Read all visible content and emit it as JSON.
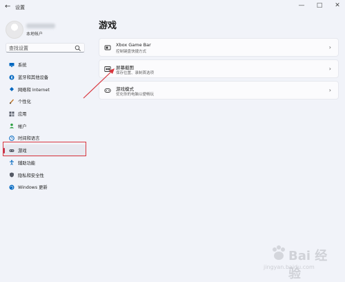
{
  "titlebar": {
    "back_glyph": "←",
    "title": "设置",
    "minimize": "—",
    "maximize": "□",
    "close": "✕"
  },
  "profile": {
    "account_type": "本地帐户"
  },
  "search": {
    "placeholder": "查找设置"
  },
  "sidebar": {
    "items": [
      {
        "label": "系统",
        "icon": "monitor-icon",
        "color": "#0067c0"
      },
      {
        "label": "蓝牙和其他设备",
        "icon": "bluetooth-icon",
        "color": "#0067c0"
      },
      {
        "label": "网络和 Internet",
        "icon": "wifi-icon",
        "color": "#0067c0"
      },
      {
        "label": "个性化",
        "icon": "brush-icon",
        "color": "#c0772a"
      },
      {
        "label": "应用",
        "icon": "apps-icon",
        "color": "#555a66"
      },
      {
        "label": "帐户",
        "icon": "person-icon",
        "color": "#2ea043"
      },
      {
        "label": "时间和语言",
        "icon": "globe-clock-icon",
        "color": "#0067c0"
      },
      {
        "label": "游戏",
        "icon": "gamepad-icon",
        "color": "#555a66",
        "active": true
      },
      {
        "label": "辅助功能",
        "icon": "accessibility-icon",
        "color": "#0067c0"
      },
      {
        "label": "隐私和安全性",
        "icon": "shield-icon",
        "color": "#555a66"
      },
      {
        "label": "Windows 更新",
        "icon": "update-icon",
        "color": "#0067c0"
      }
    ]
  },
  "main": {
    "title": "游戏",
    "cards": [
      {
        "title": "Xbox Game Bar",
        "desc": "控制键盘快捷方式",
        "icon": "xbox-game-bar-icon"
      },
      {
        "title": "屏幕截图",
        "desc": "保存位置、录制首选项",
        "icon": "capture-icon"
      },
      {
        "title": "游戏模式",
        "desc": "优化你的电脑以便畅玩",
        "icon": "game-mode-icon"
      }
    ],
    "chevron": "›"
  },
  "annotation": {
    "color": "#d9363e"
  },
  "watermark": {
    "brand": "Bai 经验",
    "url": "jingyan.baidu.com"
  }
}
